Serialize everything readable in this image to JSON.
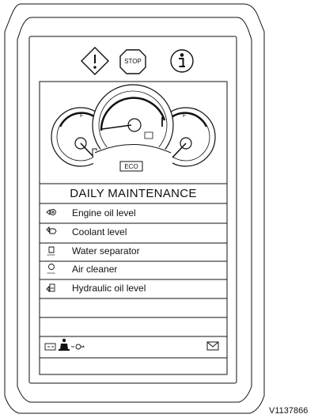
{
  "panel": {
    "title": "DAILY MAINTENANCE",
    "gauge_label": "ECO",
    "fuel_gauge_mark": "F",
    "temp_gauge_mark": "F",
    "stop_label": "STOP",
    "reference": "V1137866"
  },
  "top_icons": [
    "warning-icon",
    "stop-icon",
    "info-icon"
  ],
  "menu_items": [
    {
      "label": "Engine oil level",
      "icon": "engine-oil-icon"
    },
    {
      "label": "Coolant level",
      "icon": "coolant-icon"
    },
    {
      "label": "Water separator",
      "icon": "water-separator-icon"
    },
    {
      "label": "Air cleaner",
      "icon": "air-cleaner-icon"
    },
    {
      "label": "Hydraulic oil level",
      "icon": "hydraulic-oil-icon"
    }
  ],
  "status_icons": [
    "battery-icon",
    "operator-seat-icon",
    "engine-key-icon",
    "message-envelope-icon"
  ],
  "colors": {
    "line": "#111111",
    "background": "#ffffff"
  }
}
